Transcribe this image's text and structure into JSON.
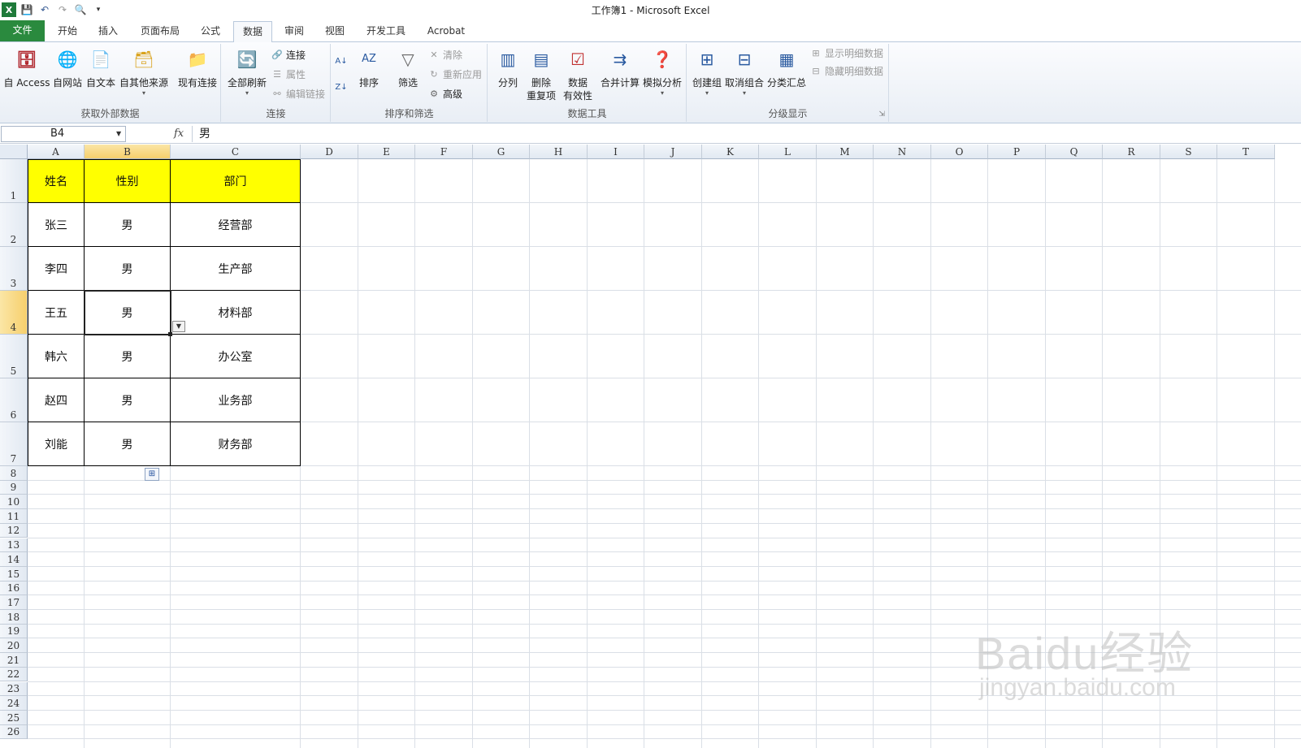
{
  "window": {
    "title": "工作簿1 - Microsoft Excel"
  },
  "qat": {
    "icons": [
      "excel-logo",
      "save",
      "undo",
      "redo",
      "print-preview",
      "customize"
    ]
  },
  "tabs": [
    {
      "label": "文件"
    },
    {
      "label": "开始"
    },
    {
      "label": "插入"
    },
    {
      "label": "页面布局"
    },
    {
      "label": "公式"
    },
    {
      "label": "数据"
    },
    {
      "label": "审阅"
    },
    {
      "label": "视图"
    },
    {
      "label": "开发工具"
    },
    {
      "label": "Acrobat"
    }
  ],
  "active_tab": "数据",
  "ribbon": {
    "external": {
      "label": "获取外部数据",
      "access": "自 Access",
      "web": "自网站",
      "text": "自文本",
      "other": "自其他来源",
      "existing": "现有连接"
    },
    "connections": {
      "label": "连接",
      "refresh_all": "全部刷新",
      "connections": "连接",
      "properties": "属性",
      "edit_links": "编辑链接"
    },
    "sort_filter": {
      "label": "排序和筛选",
      "sort": "排序",
      "filter": "筛选",
      "clear": "清除",
      "reapply": "重新应用",
      "advanced": "高级"
    },
    "data_tools": {
      "label": "数据工具",
      "text_to_columns": "分列",
      "remove_dup_1": "删除",
      "remove_dup_2": "重复项",
      "validation_1": "数据",
      "validation_2": "有效性",
      "consolidate": "合并计算",
      "whatif": "模拟分析"
    },
    "outline": {
      "label": "分级显示",
      "group": "创建组",
      "ungroup": "取消组合",
      "subtotal": "分类汇总",
      "show_detail": "显示明细数据",
      "hide_detail": "隐藏明细数据"
    }
  },
  "formula_bar": {
    "name_box": "B4",
    "fx": "fx",
    "value": "男"
  },
  "sheet": {
    "columns": [
      "A",
      "B",
      "C",
      "D",
      "E",
      "F",
      "G",
      "H",
      "I",
      "J",
      "K",
      "L",
      "M",
      "N",
      "O",
      "P",
      "Q",
      "R",
      "S",
      "T"
    ],
    "selected_column": "B",
    "selected_row": "4",
    "rows": [
      "1",
      "2",
      "3",
      "4",
      "5",
      "6",
      "7",
      "8",
      "9",
      "10",
      "11",
      "12",
      "13",
      "14",
      "15",
      "16",
      "17",
      "18",
      "19",
      "20",
      "21",
      "22",
      "23",
      "24",
      "25",
      "26"
    ],
    "header": [
      "姓名",
      "性别",
      "部门"
    ],
    "data": [
      [
        "张三",
        "男",
        "经营部"
      ],
      [
        "李四",
        "男",
        "生产部"
      ],
      [
        "王五",
        "男",
        "材料部"
      ],
      [
        "韩六",
        "男",
        "办公室"
      ],
      [
        "赵四",
        "男",
        "业务部"
      ],
      [
        "刘能",
        "男",
        "财务部"
      ]
    ],
    "header_fill": "#ffff00"
  },
  "watermark": {
    "logo": "Baidu经验",
    "url": "jingyan.baidu.com"
  }
}
